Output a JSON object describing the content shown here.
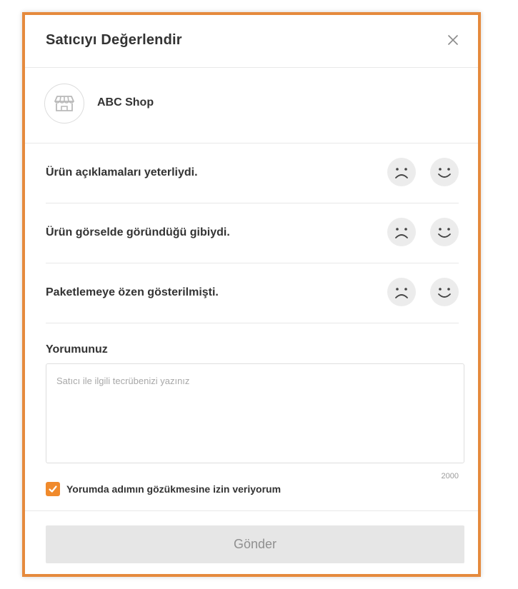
{
  "modal": {
    "title": "Satıcıyı Değerlendir"
  },
  "seller": {
    "name": "ABC Shop"
  },
  "questions": [
    {
      "label": "Ürün açıklamaları yeterliydi."
    },
    {
      "label": "Ürün görselde göründüğü gibiydi."
    },
    {
      "label": "Paketlemeye özen gösterilmişti."
    }
  ],
  "comment": {
    "label": "Yorumunuz",
    "placeholder": "Satıcı ile ilgili tecrübenizi yazınız",
    "value": "",
    "char_limit": "2000"
  },
  "consent": {
    "label": "Yorumda adımın gözükmesine izin veriyorum",
    "checked": true
  },
  "footer": {
    "submit_label": "Gönder"
  },
  "colors": {
    "frame_border": "#e58a3d",
    "checkbox": "#f08a2c",
    "face_bg": "#ececec",
    "submit_bg": "#e6e6e6",
    "submit_text": "#8f8f8f"
  },
  "icons": {
    "close": "close-icon",
    "shop": "shop-icon",
    "sad": "sad-face-icon",
    "happy": "happy-face-icon",
    "check": "check-icon"
  }
}
